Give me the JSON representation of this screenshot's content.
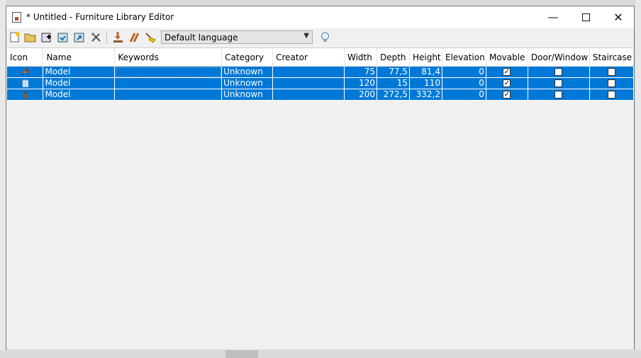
{
  "window": {
    "title": "* Untitled - Furniture Library Editor",
    "minimize": "—",
    "close": "✕"
  },
  "toolbar": {
    "icons": [
      "new-library-icon",
      "open-icon",
      "add-furniture-icon",
      "import-icon",
      "export-icon",
      "preferences-icon",
      "import-furniture-icon",
      "modify-icon",
      "clean-icon",
      "help-icon"
    ],
    "language": "Default language"
  },
  "table": {
    "columns": [
      "Icon",
      "Name",
      "Keywords",
      "Category",
      "Creator",
      "Width",
      "Depth",
      "Height",
      "Elevation",
      "Movable",
      "Door/Window",
      "Staircase"
    ],
    "rows": [
      {
        "icon": "chair-icon",
        "name": "Model",
        "keywords": "",
        "category": "Unknown",
        "creator": "",
        "width": "75",
        "depth": "77,5",
        "height": "81,4",
        "elevation": "0",
        "movable": true,
        "door_window": false,
        "staircase": false
      },
      {
        "icon": "window-icon",
        "name": "Model",
        "keywords": "",
        "category": "Unknown",
        "creator": "",
        "width": "120",
        "depth": "15",
        "height": "110",
        "elevation": "0",
        "movable": true,
        "door_window": false,
        "staircase": false
      },
      {
        "icon": "figure-icon",
        "name": "Model",
        "keywords": "",
        "category": "Unknown",
        "creator": "",
        "width": "200",
        "depth": "272,5",
        "height": "332,2",
        "elevation": "0",
        "movable": true,
        "door_window": false,
        "staircase": false
      }
    ]
  },
  "colors": {
    "selection": "#0078d7"
  }
}
